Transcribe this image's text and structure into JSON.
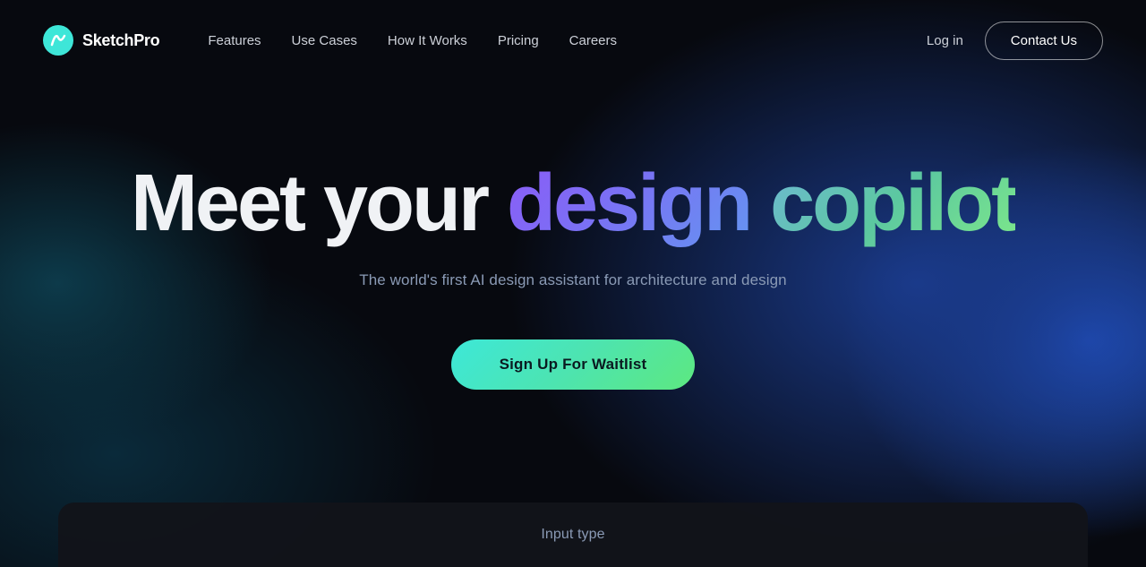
{
  "brand": {
    "name": "SketchPro"
  },
  "nav": {
    "links": [
      {
        "id": "features",
        "label": "Features"
      },
      {
        "id": "use-cases",
        "label": "Use Cases"
      },
      {
        "id": "how-it-works",
        "label": "How It Works"
      },
      {
        "id": "pricing",
        "label": "Pricing"
      },
      {
        "id": "careers",
        "label": "Careers"
      }
    ],
    "login_label": "Log in",
    "contact_label": "Contact Us"
  },
  "hero": {
    "title_part1": "Meet your ",
    "title_design": "design",
    "title_space": " ",
    "title_copilot": "copilot",
    "subtitle": "The world's first AI design assistant for architecture and design",
    "cta_label": "Sign Up For Waitlist"
  },
  "bottom_card": {
    "label": "Input type"
  },
  "colors": {
    "accent_teal": "#3de8d8",
    "accent_purple": "#8b5cf6",
    "accent_green": "#7de88a"
  }
}
